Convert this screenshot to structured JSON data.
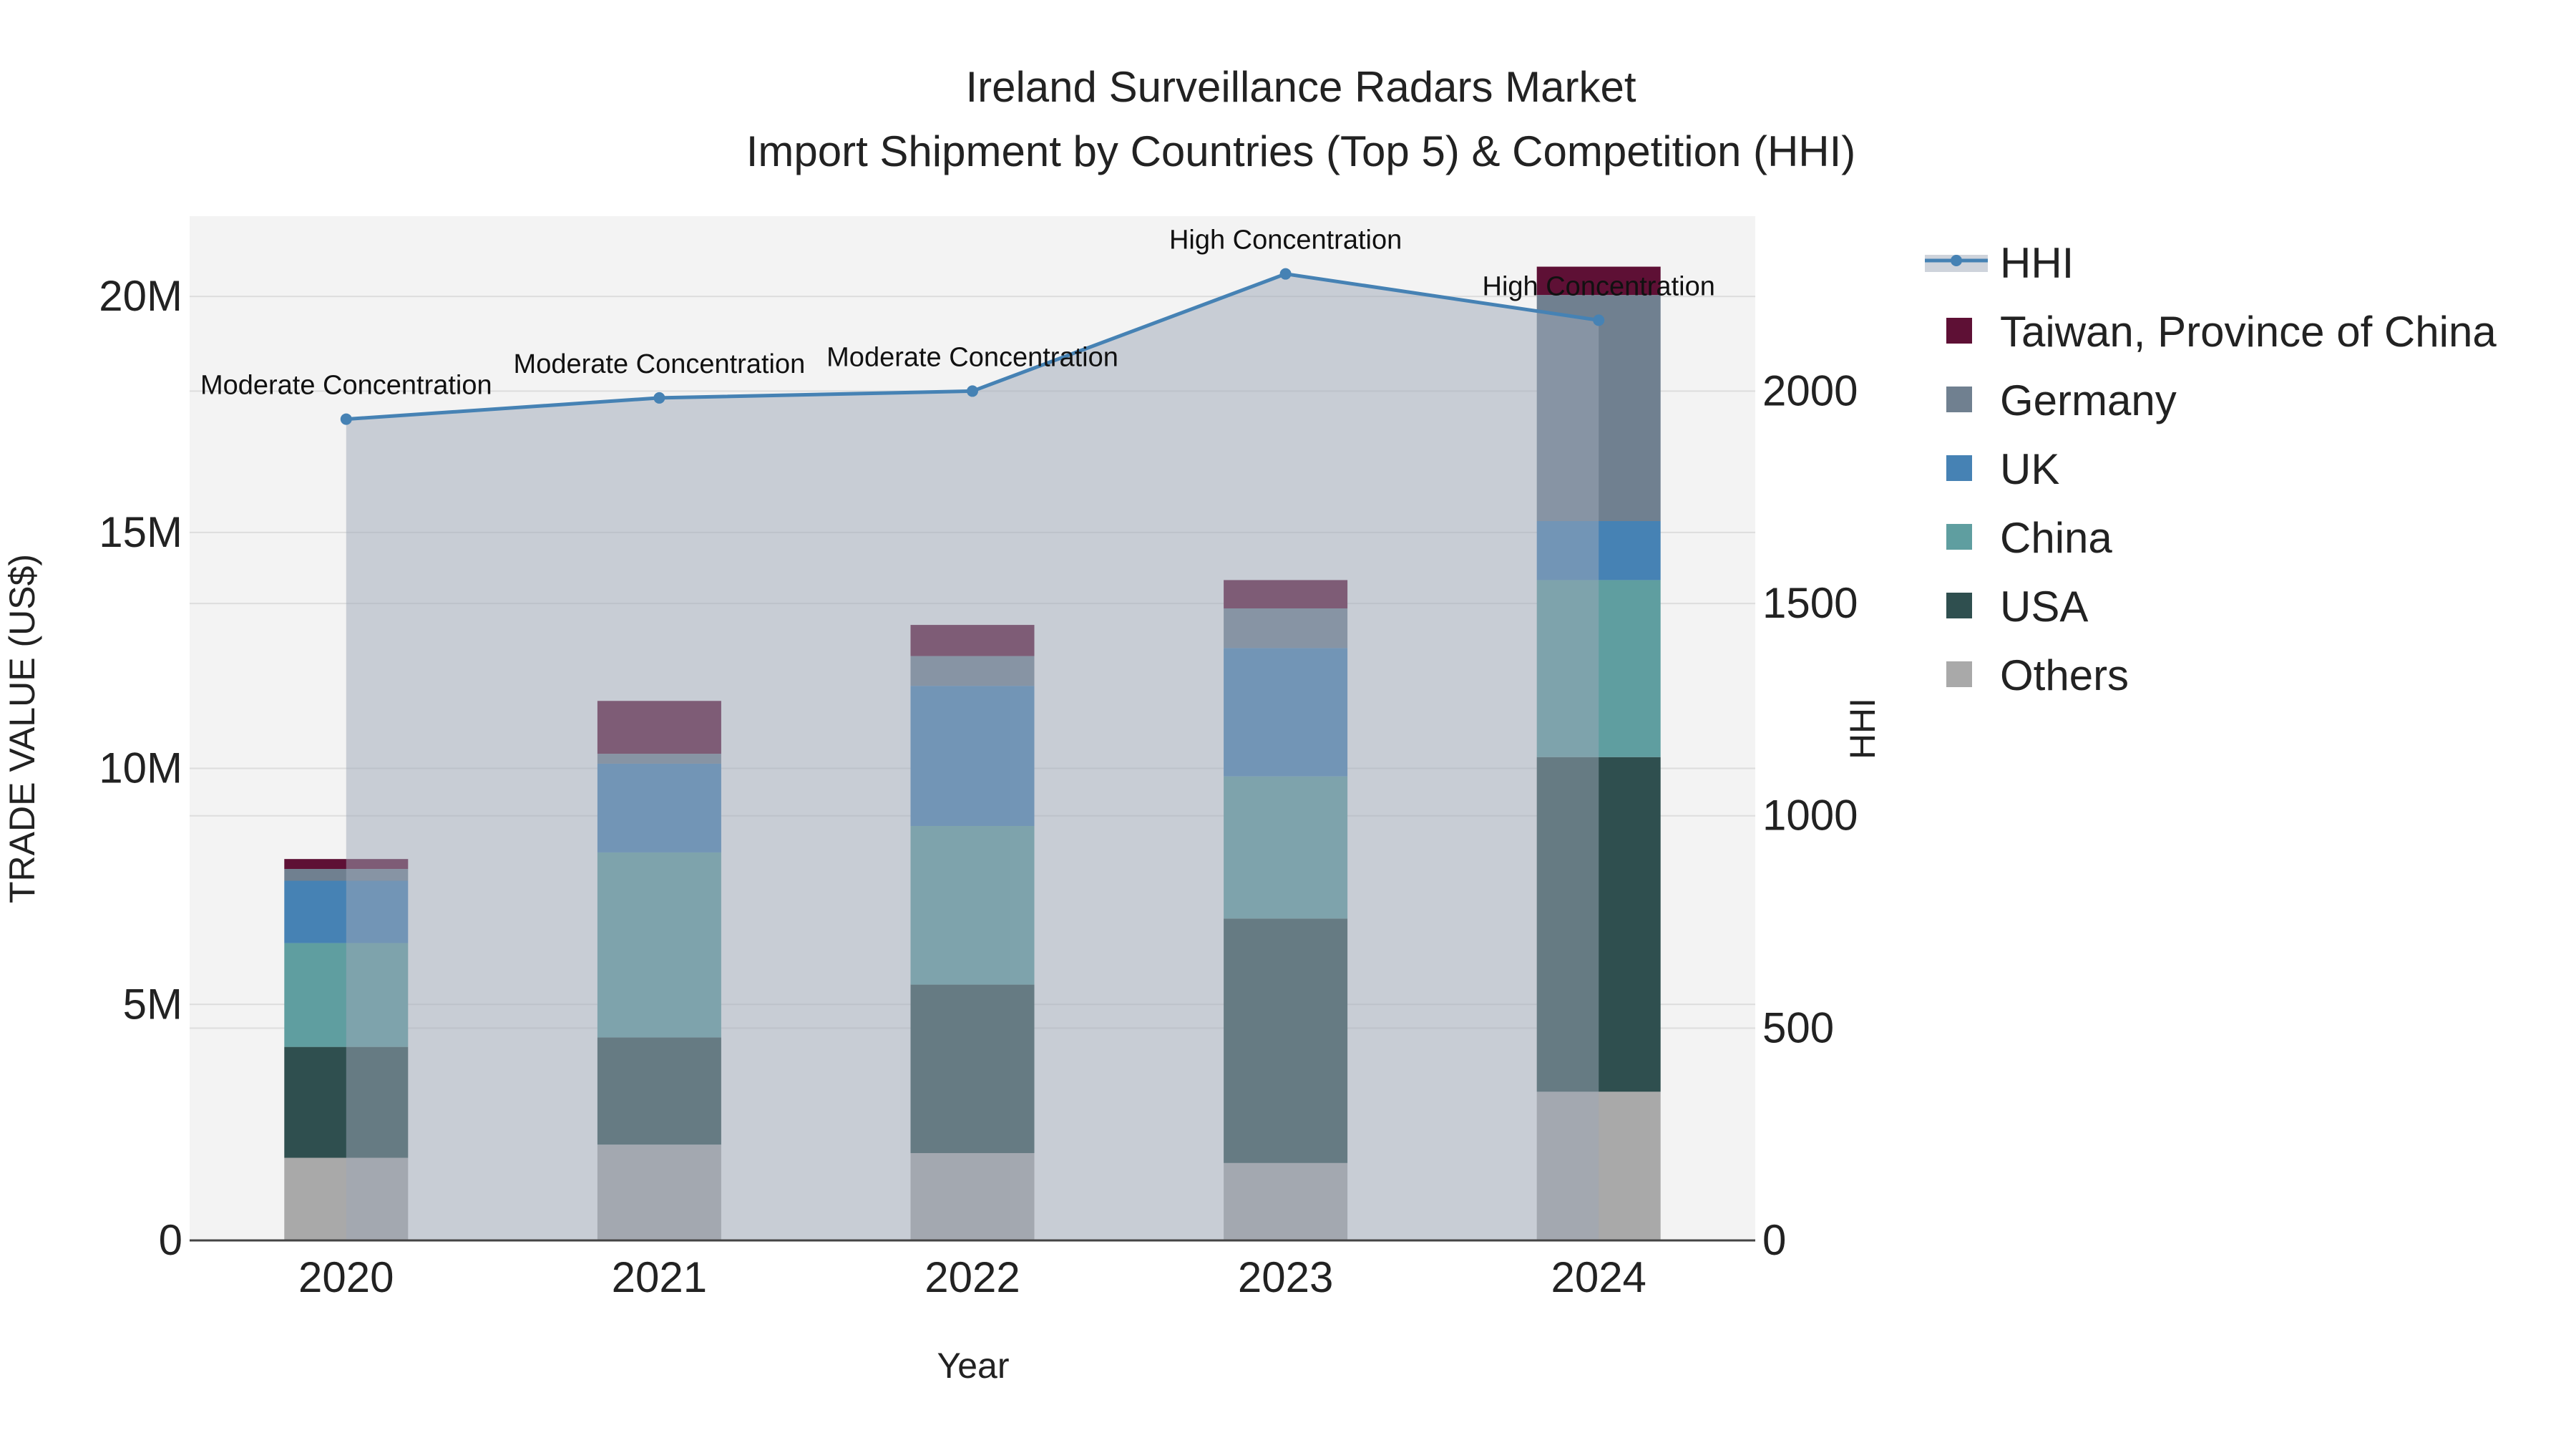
{
  "chart_data": {
    "type": "bar",
    "title": "Ireland Surveillance Radars Market",
    "subtitle": "Import Shipment by Countries (Top 5) & Competition (HHI)",
    "xlabel": "Year",
    "ylabel": "TRADE VALUE (US$)",
    "y2label": "HHI",
    "categories": [
      "2020",
      "2021",
      "2022",
      "2023",
      "2024"
    ],
    "ylim": [
      0,
      21.7
    ],
    "y_unit": "M",
    "yticks": [
      0,
      5,
      10,
      15,
      20
    ],
    "ytick_labels": [
      "0",
      "5M",
      "10M",
      "15M",
      "20M"
    ],
    "y2lim": [
      0,
      2412
    ],
    "y2ticks": [
      0,
      500,
      1000,
      1500,
      2000
    ],
    "y2tick_labels": [
      "0",
      "500",
      "1000",
      "1500",
      "2000"
    ],
    "series": [
      {
        "name": "Others",
        "color": "#a9a9a9",
        "values": [
          1.75,
          2.03,
          1.85,
          1.64,
          3.15
        ]
      },
      {
        "name": "USA",
        "color": "#2f4f4f",
        "values": [
          2.35,
          2.27,
          3.57,
          5.18,
          7.09
        ]
      },
      {
        "name": "China",
        "color": "#5f9ea0",
        "values": [
          2.2,
          3.92,
          3.36,
          3.01,
          3.75
        ]
      },
      {
        "name": "UK",
        "color": "#4682b4",
        "values": [
          1.32,
          1.88,
          2.97,
          2.72,
          1.25
        ]
      },
      {
        "name": "Germany",
        "color": "#708090",
        "values": [
          0.25,
          0.21,
          0.63,
          0.84,
          4.79
        ]
      },
      {
        "name": "Taiwan, Province of China",
        "color": "#5e1035",
        "values": [
          0.21,
          1.12,
          0.66,
          0.6,
          0.6
        ]
      }
    ],
    "hhi": {
      "name": "HHI",
      "color": "#4682b4",
      "values": [
        1934,
        1984,
        2000,
        2276,
        2167
      ],
      "annotations": [
        "Moderate Concentration",
        "Moderate Concentration",
        "Moderate Concentration",
        "High Concentration",
        "High Concentration"
      ]
    },
    "legend_order": [
      "HHI",
      "Taiwan, Province of China",
      "Germany",
      "UK",
      "China",
      "USA",
      "Others"
    ],
    "legend_placement": "right",
    "grid": true
  }
}
